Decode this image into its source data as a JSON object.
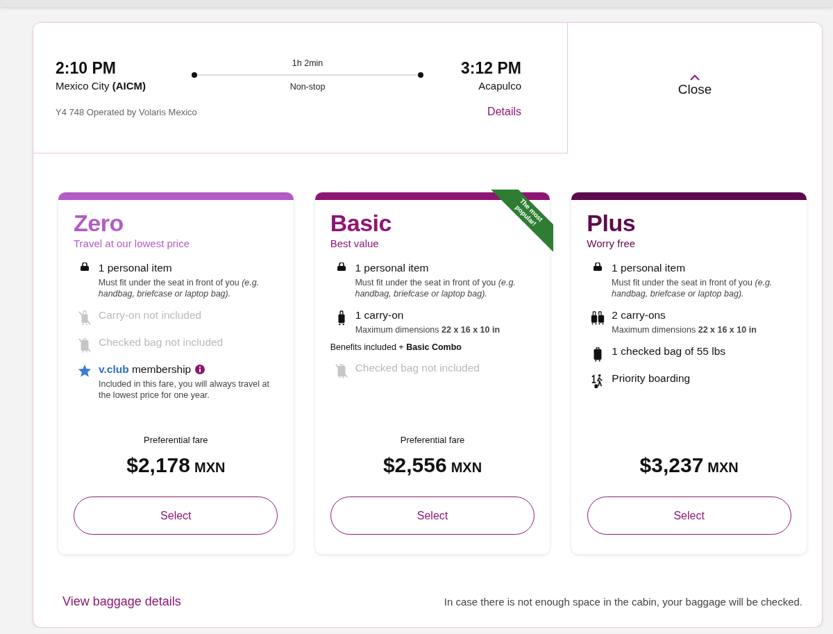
{
  "flight": {
    "departure_time": "2:10 PM",
    "departure_city": "Mexico City **(AICM)**",
    "duration": "1h 2min",
    "stops": "Non-stop",
    "arrival_time": "3:12 PM",
    "arrival_city": "Acapulco",
    "operator": "Y4 748 Operated by Volaris Mexico",
    "details_link": "Details"
  },
  "close": {
    "label": "Close"
  },
  "fares": [
    {
      "name": "Zero",
      "tagline": "Travel at our lowest price",
      "color": "#b25cc4",
      "items": [
        {
          "kind": "personal",
          "included": true,
          "title": "1 personal item",
          "detail": "Must fit under the seat in front of you *(e.g. handbag, briefcase or laptop bag).*"
        },
        {
          "kind": "carryon",
          "included": false,
          "title": "Carry-on not included"
        },
        {
          "kind": "checked",
          "included": false,
          "title": "Checked bag not included"
        },
        {
          "kind": "club",
          "included": true,
          "brand": "v.club",
          "title": "membership",
          "detail": "Included in this fare, you will always travel at the lowest price for one year."
        }
      ],
      "price_label": "Preferential fare",
      "price": "$2,178",
      "currency": "MXN",
      "button": "Select"
    },
    {
      "name": "Basic",
      "tagline": "Best value",
      "color": "#8e1673",
      "ribbon": "The most popular!",
      "items": [
        {
          "kind": "personal",
          "included": true,
          "title": "1 personal item",
          "detail": "Must fit under the seat in front of you *(e.g. handbag, briefcase or laptop bag).*"
        },
        {
          "kind": "carryon",
          "included": true,
          "title": "1 carry-on",
          "detail": "Maximum dimensions **22 x 16 x 10 in**"
        },
        {
          "kind": "benefit",
          "title": "Benefits included + **Basic Combo**"
        },
        {
          "kind": "checked",
          "included": false,
          "title": "Checked bag not included"
        }
      ],
      "price_label": "Preferential fare",
      "price": "$2,556",
      "currency": "MXN",
      "button": "Select"
    },
    {
      "name": "Plus",
      "tagline": "Worry free",
      "color": "#5e0a4e",
      "items": [
        {
          "kind": "personal",
          "included": true,
          "title": "1 personal item",
          "detail": "Must fit under the seat in front of you *(e.g. handbag, briefcase or laptop bag).*"
        },
        {
          "kind": "carryons",
          "included": true,
          "title": "2 carry-ons",
          "detail": "Maximum dimensions **22 x 16 x 10 in**"
        },
        {
          "kind": "checked",
          "included": true,
          "title": "1 checked bag of 55 lbs"
        },
        {
          "kind": "priority",
          "included": true,
          "title": "Priority boarding"
        }
      ],
      "price": "$3,237",
      "currency": "MXN",
      "button": "Select"
    }
  ],
  "footer": {
    "link": "View baggage details",
    "note": "In case there is not enough space in the cabin, your baggage will be checked."
  }
}
